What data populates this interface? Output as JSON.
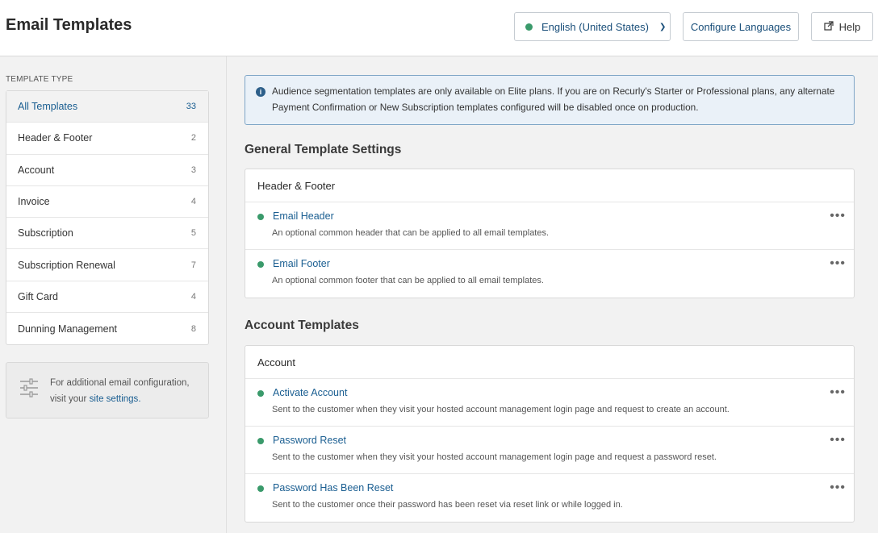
{
  "header": {
    "title": "Email Templates",
    "language_label": "English (United States)",
    "configure_label": "Configure Languages",
    "help_label": "Help"
  },
  "sidebar": {
    "section_label": "TEMPLATE TYPE",
    "items": [
      {
        "label": "All Templates",
        "count": "33",
        "active": true
      },
      {
        "label": "Header & Footer",
        "count": "2"
      },
      {
        "label": "Account",
        "count": "3"
      },
      {
        "label": "Invoice",
        "count": "4"
      },
      {
        "label": "Subscription",
        "count": "5"
      },
      {
        "label": "Subscription Renewal",
        "count": "7"
      },
      {
        "label": "Gift Card",
        "count": "4"
      },
      {
        "label": "Dunning Management",
        "count": "8"
      }
    ],
    "config_text_before": "For additional email configuration, visit your ",
    "config_link": "site settings",
    "config_text_after": "."
  },
  "notice": {
    "text": "Audience segmentation templates are only available on Elite plans. If you are on Recurly's Starter or Professional plans, any alternate Payment Confirmation or New Subscription templates configured will be disabled once on production."
  },
  "sections": [
    {
      "title": "General Template Settings",
      "card_title": "Header & Footer",
      "templates": [
        {
          "name": "Email Header",
          "desc": "An optional common header that can be applied to all email templates."
        },
        {
          "name": "Email Footer",
          "desc": "An optional common footer that can be applied to all email templates."
        }
      ]
    },
    {
      "title": "Account Templates",
      "card_title": "Account",
      "templates": [
        {
          "name": "Activate Account",
          "desc": "Sent to the customer when they visit your hosted account management login page and request to create an account."
        },
        {
          "name": "Password Reset",
          "desc": "Sent to the customer when they visit your hosted account management login page and request a password reset."
        },
        {
          "name": "Password Has Been Reset",
          "desc": "Sent to the customer once their password has been reset via reset link or while logged in."
        }
      ]
    }
  ],
  "colors": {
    "accent": "#1a5e91",
    "status_green": "#3a9a6b"
  }
}
